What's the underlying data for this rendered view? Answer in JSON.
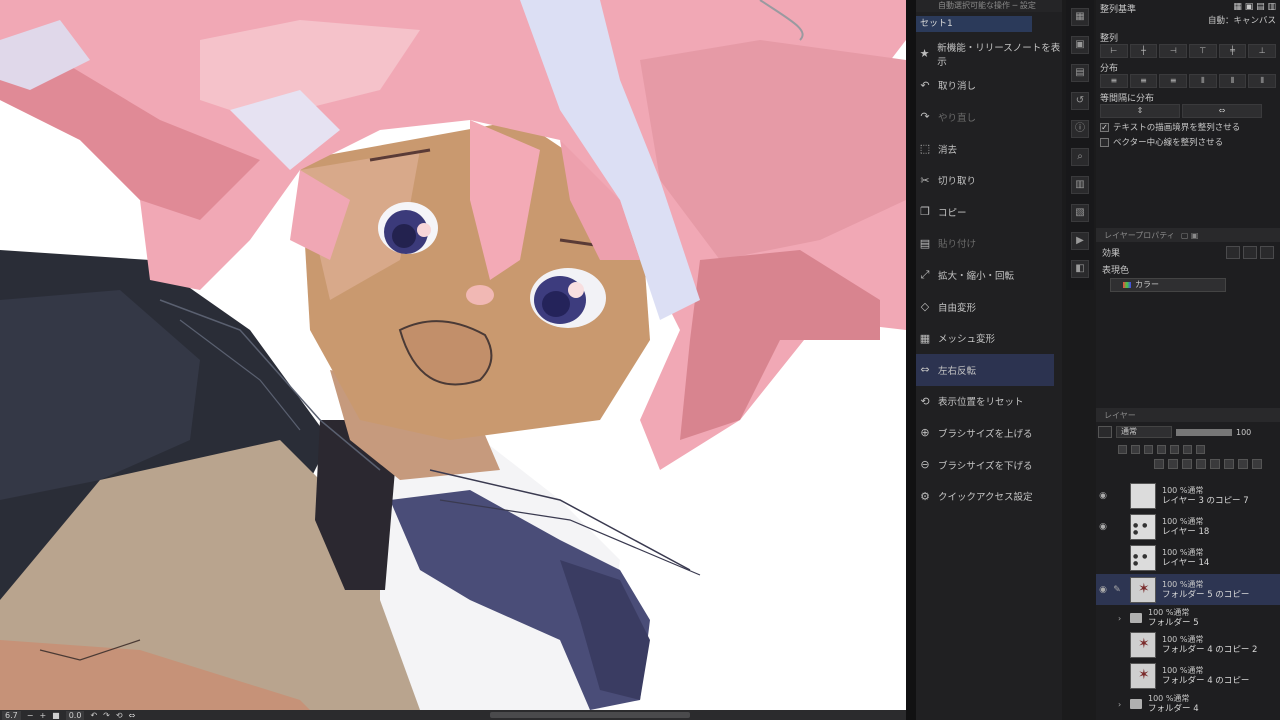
{
  "quick_access": {
    "header": "自動選択可能な操作 ─ 設定",
    "set_name": "セット1",
    "items": [
      {
        "label": "新機能・リリースノートを表示",
        "icon": "star-icon",
        "dim": false
      },
      {
        "label": "取り消し",
        "icon": "undo-icon",
        "dim": false
      },
      {
        "label": "やり直し",
        "icon": "redo-icon",
        "dim": true
      },
      {
        "label": "消去",
        "icon": "erase-icon",
        "dim": false
      },
      {
        "label": "切り取り",
        "icon": "cut-icon",
        "dim": false
      },
      {
        "label": "コピー",
        "icon": "copy-icon",
        "dim": false
      },
      {
        "label": "貼り付け",
        "icon": "paste-icon",
        "dim": true
      },
      {
        "label": "拡大・縮小・回転",
        "icon": "scale-icon",
        "dim": false
      },
      {
        "label": "自由変形",
        "icon": "free-transform-icon",
        "dim": false
      },
      {
        "label": "メッシュ変形",
        "icon": "mesh-icon",
        "dim": false
      },
      {
        "label": "左右反転",
        "icon": "flip-icon",
        "dim": false
      },
      {
        "label": "表示位置をリセット",
        "icon": "reset-view-icon",
        "dim": false
      },
      {
        "label": "ブラシサイズを上げる",
        "icon": "brush-up-icon",
        "dim": false
      },
      {
        "label": "ブラシサイズを下げる",
        "icon": "brush-down-icon",
        "dim": false
      },
      {
        "label": "クイックアクセス設定",
        "icon": "settings-icon",
        "dim": false
      }
    ]
  },
  "align": {
    "title": "整列基準",
    "basis": "自動：キャンバス",
    "align_label": "整列",
    "distribute_label": "分布",
    "equal_spacing_label": "等間隔に分布",
    "check1": "テキストの描画境界を整列させる",
    "check2": "ベクター中心線を整列させる"
  },
  "props": {
    "tab": "レイヤープロパティ",
    "effect_label": "効果",
    "expression_label": "表現色",
    "expression_value": "カラー"
  },
  "layers": {
    "tab": "レイヤー",
    "blend": "通常",
    "opacity": "100",
    "items": [
      {
        "mode": "100 %通常",
        "name": "レイヤー 3 のコピー 7",
        "type": "layer"
      },
      {
        "mode": "100 %通常",
        "name": "レイヤー 18",
        "type": "dots"
      },
      {
        "mode": "100 %通常",
        "name": "レイヤー 14",
        "type": "dots"
      },
      {
        "mode": "100 %通常",
        "name": "フォルダー 5 のコピー",
        "type": "art"
      },
      {
        "mode": "100 %通常",
        "name": "フォルダー 5",
        "type": "folder"
      },
      {
        "mode": "100 %通常",
        "name": "フォルダー 4 のコピー 2",
        "type": "art"
      },
      {
        "mode": "100 %通常",
        "name": "フォルダー 4 のコピー",
        "type": "art"
      },
      {
        "mode": "100 %通常",
        "name": "フォルダー 4",
        "type": "folder"
      }
    ]
  },
  "status": {
    "zoom": "6.7",
    "angle": "0.0"
  },
  "colors": {
    "selection": "#2d3552",
    "panel": "#1e1e20",
    "hair": "#f0a7b4",
    "skin": "#c89a7a"
  }
}
